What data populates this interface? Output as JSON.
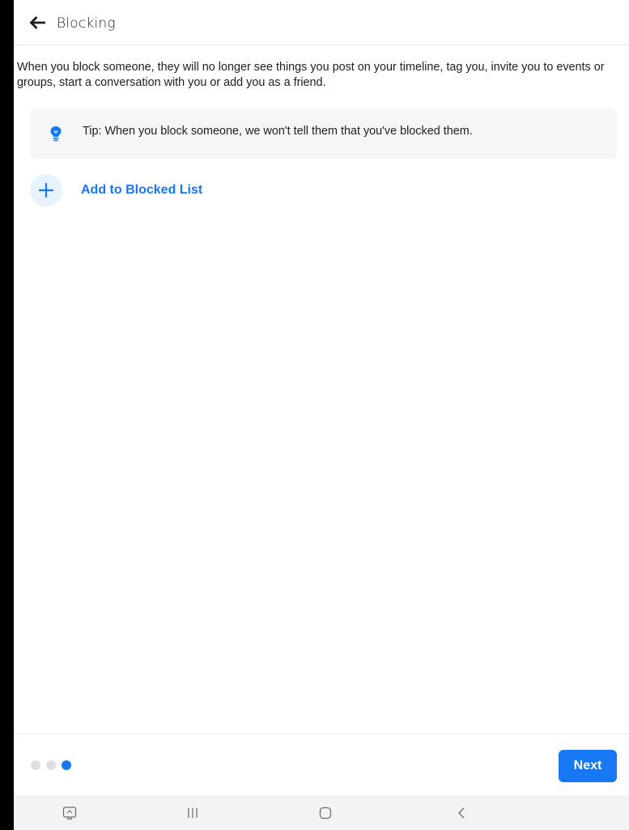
{
  "header": {
    "back_icon": "arrow-left-icon",
    "title": "Blocking"
  },
  "description": "When you block someone, they will no longer see things you post on your timeline, tag you, invite you to events or groups, start a conversation with you or add you as a friend.",
  "tip": {
    "icon": "lightbulb-icon",
    "text": "Tip: When you block someone, we won't tell them that you've blocked them."
  },
  "add_to_blocked": {
    "icon": "plus-icon",
    "label": "Add to Blocked List"
  },
  "footer": {
    "step_current": 3,
    "step_total": 3,
    "next_label": "Next"
  },
  "system_nav": {
    "items": [
      "screenshot-icon",
      "recent-apps-icon",
      "home-icon",
      "back-icon"
    ]
  },
  "colors": {
    "accent": "#1877f2",
    "tip_background": "#f5f6f7",
    "add_circle_background": "#e7f3ff"
  }
}
